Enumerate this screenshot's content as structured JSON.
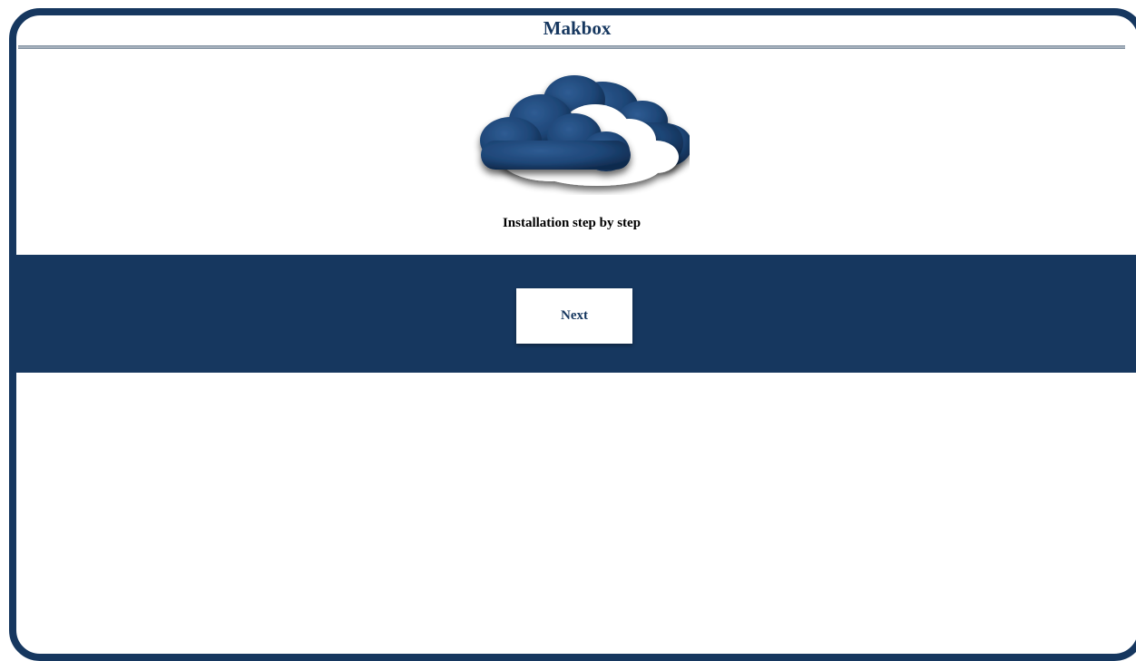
{
  "header": {
    "title": "Makbox"
  },
  "logo": {
    "icon": "cloud-icon",
    "colors": {
      "dark_cloud": "#1e4677",
      "light_cloud": "#ffffff"
    }
  },
  "main": {
    "subtitle": "Installation step by step",
    "next_label": "Next"
  },
  "colors": {
    "brand": "#16375f",
    "background": "#ffffff",
    "text": "#000000"
  }
}
